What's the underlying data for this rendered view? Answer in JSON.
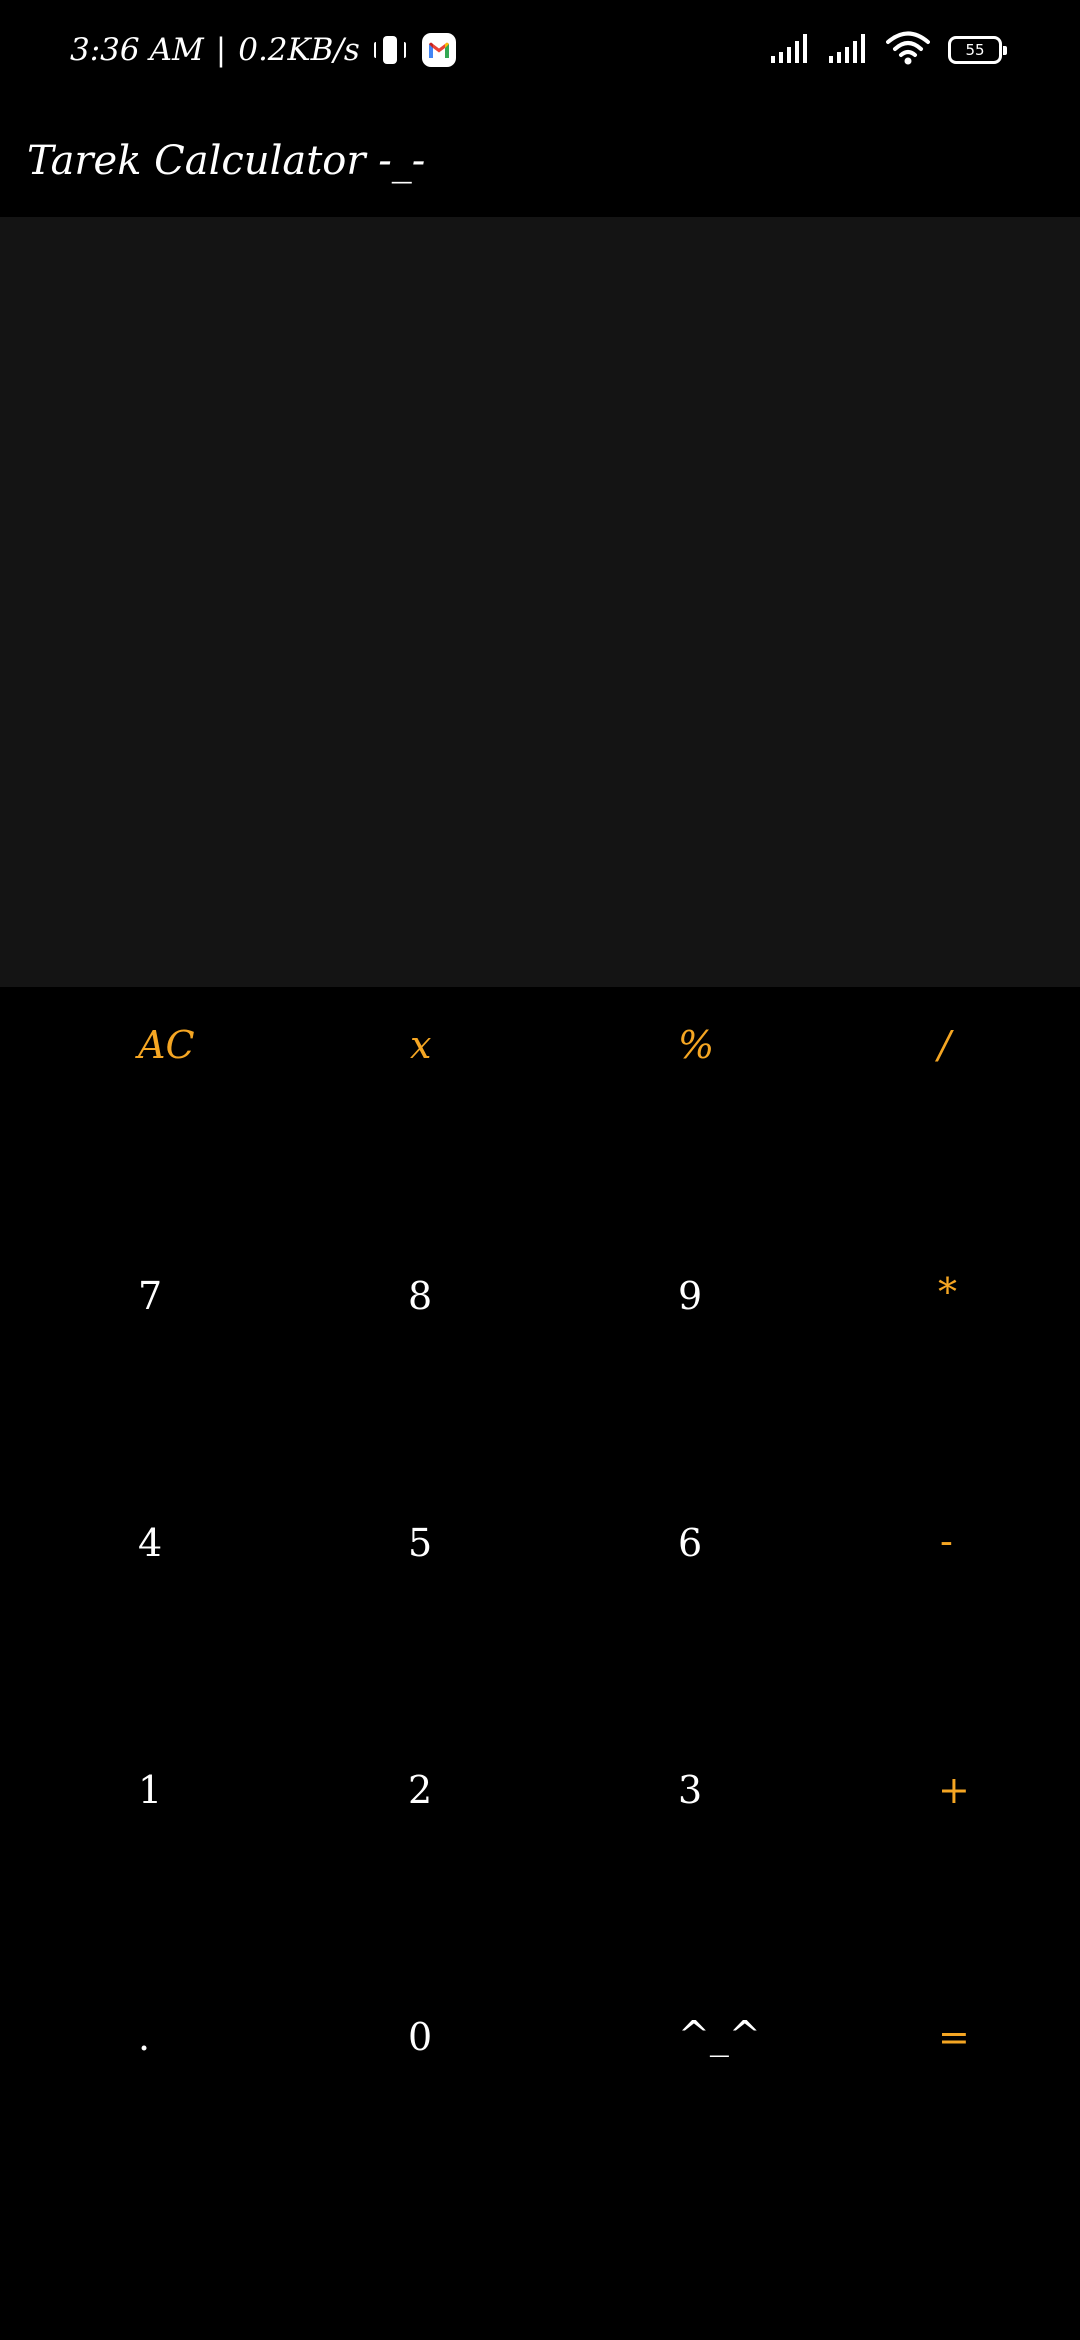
{
  "status_bar": {
    "time": "3:36",
    "ampm": "AM",
    "separator": "|",
    "net_speed": "0.2KB/s",
    "icons": [
      "vibrate-icon",
      "gmail-icon",
      "signal-icon",
      "signal-icon",
      "wifi-icon",
      "battery-icon"
    ],
    "battery": "55"
  },
  "app_bar": {
    "title": "Tarek Calculator -_-"
  },
  "display": {
    "text": ""
  },
  "keypad": {
    "row1": [
      "AC",
      "x",
      "%",
      "/"
    ],
    "row2": [
      "7",
      "8",
      "9",
      "*"
    ],
    "row3": [
      "4",
      "5",
      "6",
      "-"
    ],
    "row4": [
      "1",
      "2",
      "3",
      "+"
    ],
    "row5": [
      ".",
      "0",
      "^_^",
      "="
    ]
  },
  "colors": {
    "background": "#000000",
    "display_background": "#141414",
    "accent": "#f5a623",
    "text": "#ffffff"
  }
}
